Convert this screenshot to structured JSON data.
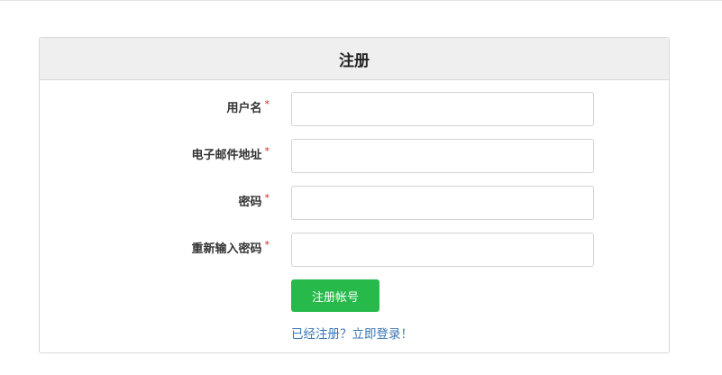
{
  "form": {
    "title": "注册",
    "required_mark": "*",
    "fields": [
      {
        "label": "用户名",
        "value": "",
        "placeholder": ""
      },
      {
        "label": "电子邮件地址",
        "value": "",
        "placeholder": ""
      },
      {
        "label": "密码",
        "value": "",
        "placeholder": ""
      },
      {
        "label": "重新输入密码",
        "value": "",
        "placeholder": ""
      }
    ],
    "submit_label": "注册帐号",
    "login_link": "已经注册？立即登录！"
  },
  "colors": {
    "submit_button": "#27b94a",
    "link": "#3c76b5",
    "required_mark": "#e02020",
    "heading_background": "#efefef"
  }
}
